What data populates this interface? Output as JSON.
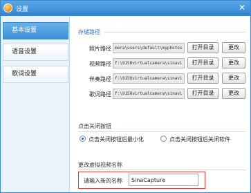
{
  "window": {
    "title": "设置",
    "close_label": "✕"
  },
  "sidebar": {
    "items": [
      {
        "label": "基本设置"
      },
      {
        "label": "语音设置"
      },
      {
        "label": "歌词设置"
      }
    ]
  },
  "storage": {
    "section_title": "存储路径",
    "rows": [
      {
        "label": "照片路径",
        "path": "mera\\users\\default\\myphotos"
      },
      {
        "label": "视频路径",
        "path": "f:\\9158virtualcamera\\sinavi"
      },
      {
        "label": "伴奏路径",
        "path": "f:\\9158virtualcamera\\sinavi"
      },
      {
        "label": "歌词路径",
        "path": "f:\\9158virtualcamera\\sinavi"
      }
    ],
    "open_label": "打开目录",
    "change_label": "更改"
  },
  "close_button": {
    "section_title": "点击关闭按钮",
    "options": [
      {
        "label": "点击关闭按钮后最小化",
        "checked": true
      },
      {
        "label": "点击关闭按钮后关闭软件",
        "checked": false
      }
    ]
  },
  "rename": {
    "section_title": "更改虚拟视频名称",
    "label": "请输入新的名称",
    "value": "SinaCapture"
  }
}
